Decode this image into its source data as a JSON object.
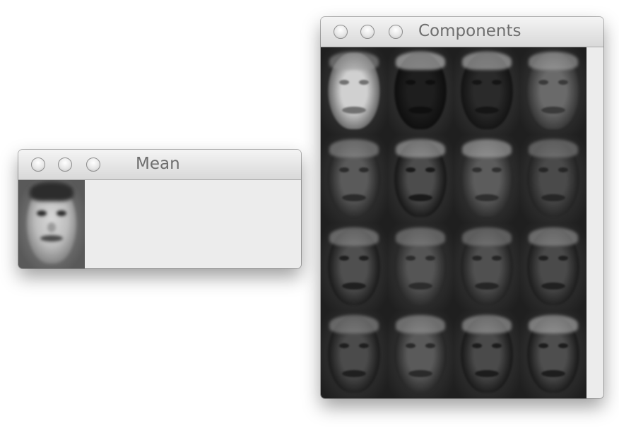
{
  "mean_window": {
    "title": "Mean"
  },
  "components_window": {
    "title": "Components",
    "grid": {
      "rows": 4,
      "columns": 4
    }
  },
  "icons": [
    "close-button",
    "minimize-button",
    "zoom-button"
  ]
}
